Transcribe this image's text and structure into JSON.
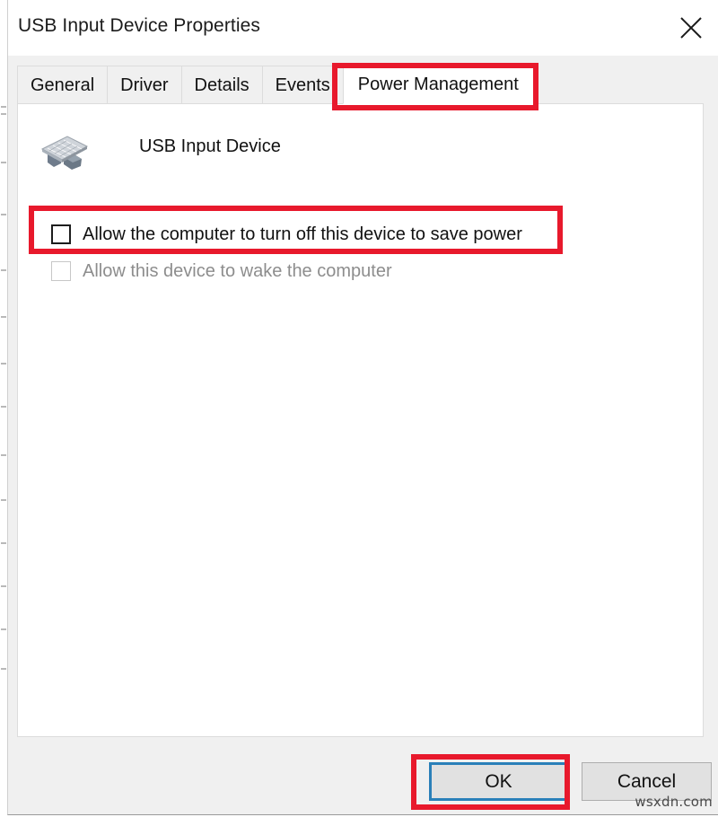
{
  "window": {
    "title": "USB Input Device Properties",
    "close_icon": "close-icon"
  },
  "tabs": [
    {
      "label": "General",
      "active": false
    },
    {
      "label": "Driver",
      "active": false
    },
    {
      "label": "Details",
      "active": false
    },
    {
      "label": "Events",
      "active": false
    },
    {
      "label": "Power Management",
      "active": true
    }
  ],
  "content": {
    "device": {
      "icon": "usb-input-device-icon",
      "name": "USB Input Device"
    },
    "options": [
      {
        "label": "Allow the computer to turn off this device to save power",
        "checked": false,
        "disabled": false
      },
      {
        "label": "Allow this device to wake the computer",
        "checked": false,
        "disabled": true
      }
    ]
  },
  "footer": {
    "ok_label": "OK",
    "cancel_label": "Cancel"
  },
  "watermark": "wsxdn.com",
  "annotations": {
    "color": "#e8192c",
    "targets": [
      "power-management-tab",
      "turn-off-device-checkbox",
      "ok-button"
    ]
  }
}
